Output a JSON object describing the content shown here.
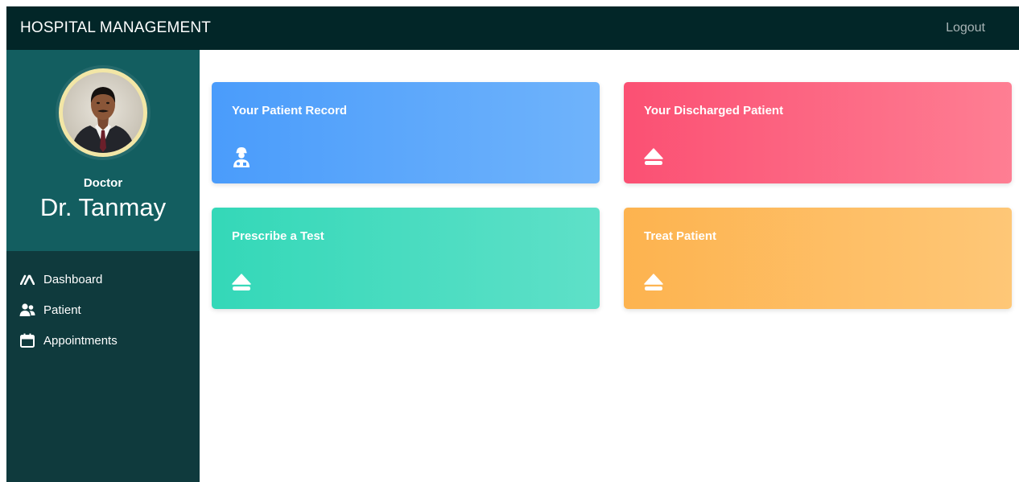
{
  "header": {
    "title": "HOSPITAL MANAGEMENT",
    "logout_label": "Logout"
  },
  "profile": {
    "role": "Doctor",
    "name": "Dr. Tanmay"
  },
  "sidebar": {
    "items": [
      {
        "label": "Dashboard",
        "icon": "tachometer-icon"
      },
      {
        "label": "Patient",
        "icon": "users-icon"
      },
      {
        "label": "Appointments",
        "icon": "calendar-icon"
      }
    ]
  },
  "cards": [
    {
      "title": "Your Patient Record",
      "icon": "user-injured-icon",
      "color": "#4a9cfb"
    },
    {
      "title": "Your Discharged Patient",
      "icon": "eject-icon",
      "color": "#fb5073"
    },
    {
      "title": "Prescribe a Test",
      "icon": "eject-icon",
      "color": "#34d8b8"
    },
    {
      "title": "Treat Patient",
      "icon": "eject-icon",
      "color": "#fdb34f"
    }
  ],
  "colors": {
    "topbar": "#022628",
    "sidebar": "#0f3a3d",
    "profile_panel": "#135e60"
  }
}
